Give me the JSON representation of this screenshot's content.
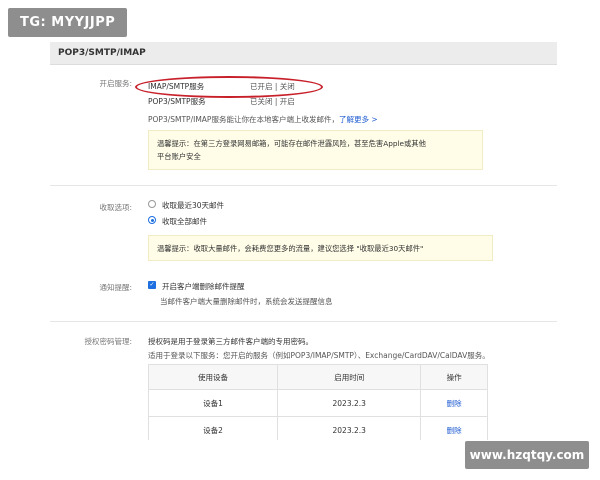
{
  "watermark": {
    "top_left": "TG: MYYJJPP",
    "bottom_right": "www.hzqtqy.com"
  },
  "panel": {
    "title": "POP3/SMTP/IMAP",
    "services": {
      "label": "开启服务:",
      "rows": [
        {
          "name": "IMAP/SMTP服务",
          "status": "已开启",
          "sep": " | ",
          "action": "关闭",
          "highlighted": true
        },
        {
          "name": "POP3/SMTP服务",
          "status": "已关闭",
          "sep": " | ",
          "action": "开启",
          "highlighted": false
        }
      ],
      "desc": "POP3/SMTP/IMAP服务能让你在本地客户端上收发邮件，",
      "learn_more": "了解更多 >",
      "tip_line1": "温馨提示：在第三方登录网易邮箱，可能存在邮件泄露风险，甚至危害Apple或其他",
      "tip_line2": "平台账户安全"
    },
    "receive": {
      "label": "收取选项:",
      "options": [
        {
          "label": "收取最近30天邮件",
          "checked": false
        },
        {
          "label": "收取全部邮件",
          "checked": true
        }
      ],
      "tip": "温馨提示：收取大量邮件，会耗费您更多的流量，建议您选择 \"收取最近30天邮件\""
    },
    "notify": {
      "label": "通知提醒:",
      "checkbox_label": "开启客户端删除邮件提醒",
      "checked": true,
      "sub": "当邮件客户端大量删除邮件时，系统会发送提醒信息"
    },
    "auth": {
      "label": "授权密码管理:",
      "line1": "授权码是用于登录第三方邮件客户端的专用密码。",
      "line2": "适用于登录以下服务：您开启的服务（例如POP3/IMAP/SMTP）、Exchange/CardDAV/CalDAV服务。",
      "table": {
        "headers": [
          "使用设备",
          "启用时间",
          "操作"
        ],
        "rows": [
          [
            "设备1",
            "2023.2.3",
            "删除"
          ],
          [
            "设备2",
            "2023.2.3",
            "删除"
          ]
        ]
      }
    }
  },
  "colors": {
    "accent": "#1e6fe0",
    "highlight_ellipse": "#c8202a",
    "tip_bg": "#fffde8",
    "header_bg": "#ececec"
  },
  "icons": {
    "receive_radio": "radio-button-icon",
    "notify_check": "checkbox-checked-icon"
  }
}
